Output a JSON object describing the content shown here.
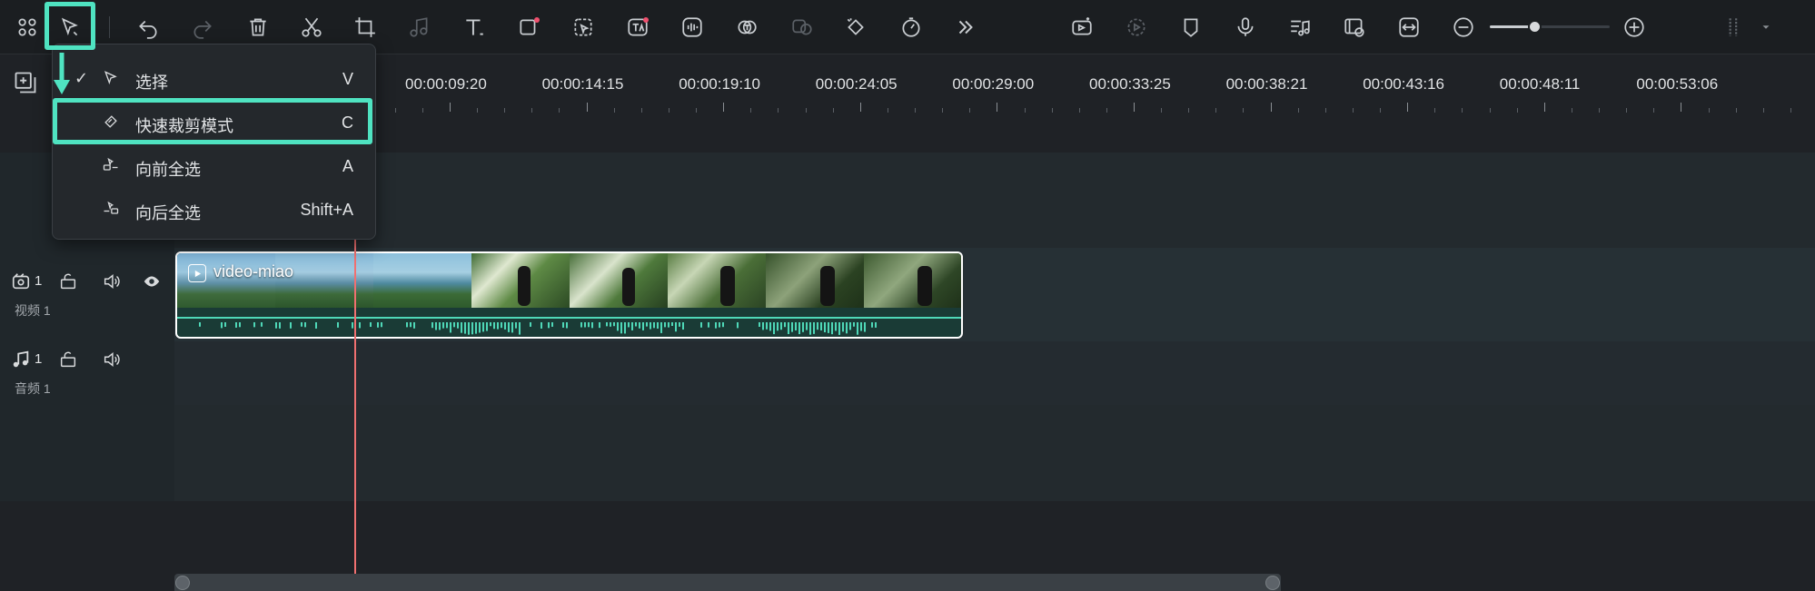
{
  "toolbar": {
    "items": [
      "apps-icon",
      "select-tool-icon",
      "undo-icon",
      "redo-icon",
      "delete-icon",
      "cut-icon",
      "crop-icon",
      "audio-icon",
      "text-icon",
      "shape-icon",
      "ai-tool-icon",
      "ai-text-icon",
      "voice-icon",
      "subtitle-icon",
      "audio-sync-icon",
      "keyframe-icon",
      "speed-icon",
      "more-icon"
    ],
    "right_items": [
      "ai-video-icon",
      "render-icon",
      "marker-icon",
      "mic-icon",
      "music-icon",
      "track-manage-icon",
      "fit-icon",
      "zoom-out-icon",
      "zoom-in-icon",
      "layout-icon"
    ]
  },
  "zoom": {
    "level": 0.37
  },
  "ruler": {
    "labels": [
      "00:00:09:20",
      "00:00:14:15",
      "00:00:19:10",
      "00:00:24:05",
      "00:00:29:00",
      "00:00:33:25",
      "00:00:38:21",
      "00:00:43:16",
      "00:00:48:11",
      "00:00:53:06"
    ]
  },
  "tracks": {
    "video": {
      "number": "1",
      "label": "视频 1"
    },
    "audio": {
      "number": "1",
      "label": "音频 1"
    }
  },
  "clip": {
    "title": "video-miao"
  },
  "menu": {
    "items": [
      {
        "label": "选择",
        "shortcut": "V",
        "checked": true,
        "icon": "cursor-icon"
      },
      {
        "label": "快速裁剪模式",
        "shortcut": "C",
        "checked": false,
        "icon": "blade-icon"
      },
      {
        "label": "向前全选",
        "shortcut": "A",
        "checked": false,
        "icon": "select-forward-icon"
      },
      {
        "label": "向后全选",
        "shortcut": "Shift+A",
        "checked": false,
        "icon": "select-backward-icon"
      }
    ]
  },
  "colors": {
    "accent": "#4fe3c1",
    "playhead": "#f07070",
    "audio_wave": "#4fd8b8"
  }
}
